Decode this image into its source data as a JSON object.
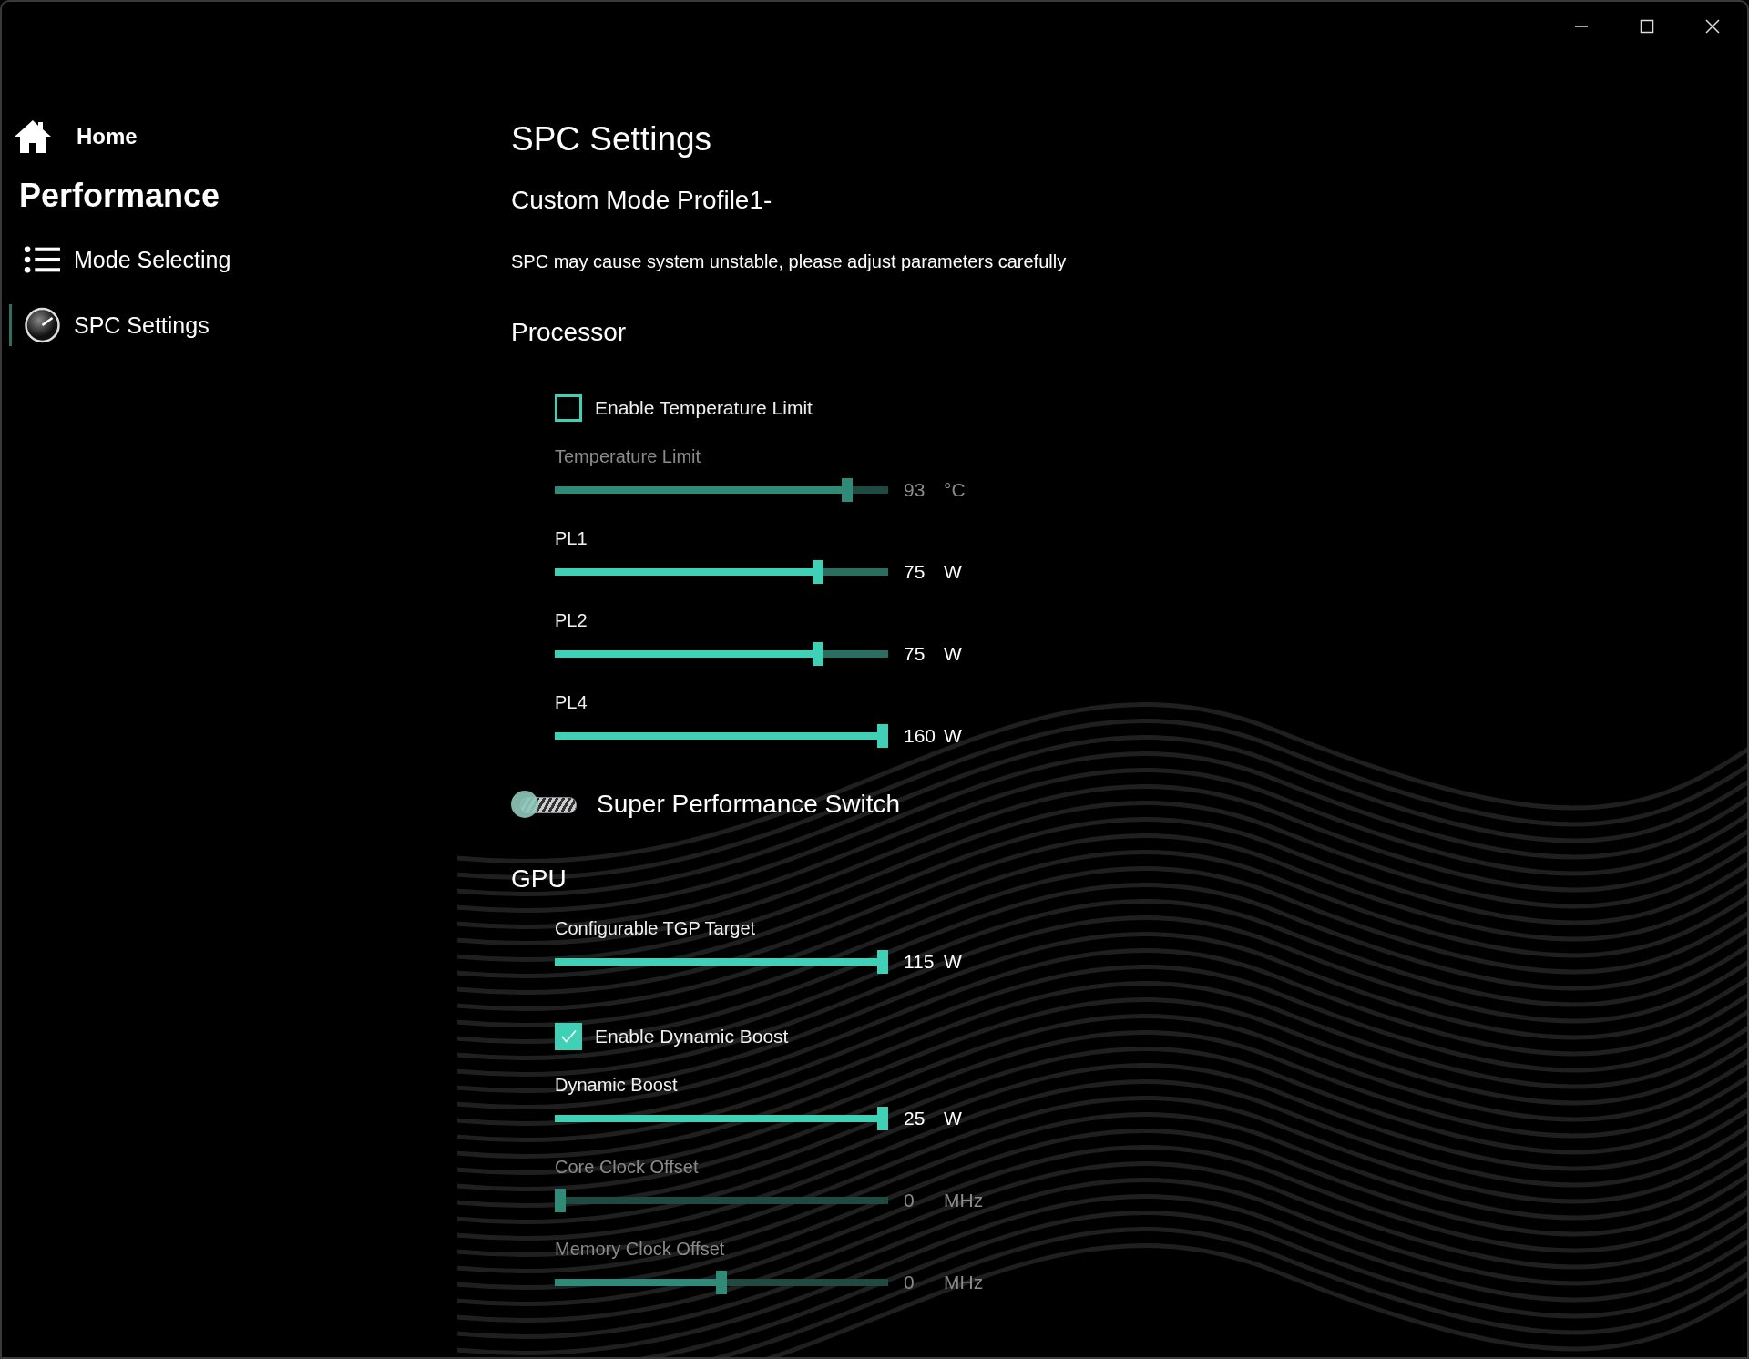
{
  "sidebar": {
    "home": "Home",
    "section_title": "Performance",
    "items": [
      {
        "label": "Mode Selecting",
        "kind": "list",
        "selected": false
      },
      {
        "label": "SPC Settings",
        "kind": "gauge",
        "selected": true
      }
    ]
  },
  "page": {
    "title": "SPC Settings",
    "profile": "Custom Mode Profile1-",
    "warning": "SPC may cause system unstable, please adjust parameters carefully"
  },
  "controls": [
    {
      "kind": "heading",
      "label": "Processor"
    },
    {
      "kind": "checkbox",
      "label": "Enable Temperature Limit",
      "checked": false
    },
    {
      "kind": "slider",
      "label": "Temperature Limit",
      "value": "93",
      "unit": "°C",
      "level": 0.89,
      "disabled": true
    },
    {
      "kind": "slider",
      "label": "PL1",
      "value": "75",
      "unit": "W",
      "level": 0.8,
      "disabled": false
    },
    {
      "kind": "slider",
      "label": "PL2",
      "value": "75",
      "unit": "W",
      "level": 0.8,
      "disabled": false
    },
    {
      "kind": "slider",
      "label": "PL4",
      "value": "160",
      "unit": "W",
      "level": 1,
      "disabled": false
    },
    {
      "kind": "switch",
      "label": "Super Performance Switch",
      "on": false
    },
    {
      "kind": "heading",
      "label": "GPU"
    },
    {
      "kind": "slider",
      "label": "Configurable TGP Target",
      "value": "115",
      "unit": "W",
      "level": 1,
      "disabled": false
    },
    {
      "kind": "checkbox",
      "label": "Enable Dynamic Boost",
      "checked": true
    },
    {
      "kind": "slider",
      "label": "Dynamic Boost",
      "value": "25",
      "unit": "W",
      "level": 1,
      "disabled": false
    },
    {
      "kind": "slider",
      "label": "Core Clock Offset",
      "value": "0",
      "unit": "MHz",
      "level": 0,
      "disabled": true
    },
    {
      "kind": "slider",
      "label": "Memory Clock Offset",
      "value": "0",
      "unit": "MHz",
      "level": 0.5,
      "disabled": true
    }
  ]
}
